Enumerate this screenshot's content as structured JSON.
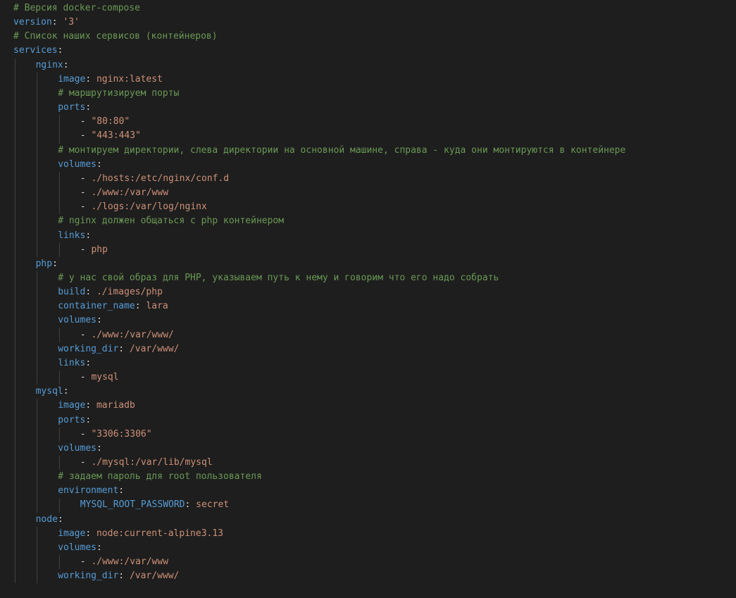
{
  "editor": {
    "language": "yaml",
    "theme": "dark",
    "colors": {
      "background": "#1e1e1e",
      "comment": "#6a9955",
      "key": "#569cd6",
      "string": "#ce9178",
      "punctuation": "#d4d4d4",
      "indent_guide": "#404040",
      "active_indent_guide": "#707070"
    },
    "current_line": 41,
    "lines": [
      {
        "indent": 0,
        "tokens": [
          {
            "t": "c",
            "v": "# Версия docker-compose"
          }
        ]
      },
      {
        "indent": 0,
        "tokens": [
          {
            "t": "k",
            "v": "version"
          },
          {
            "t": "p",
            "v": ": "
          },
          {
            "t": "s",
            "v": "'3'"
          }
        ]
      },
      {
        "indent": 0,
        "tokens": [
          {
            "t": "c",
            "v": "# Список наших сервисов (контейнеров)"
          }
        ]
      },
      {
        "indent": 0,
        "tokens": [
          {
            "t": "k",
            "v": "services"
          },
          {
            "t": "p",
            "v": ":"
          }
        ]
      },
      {
        "indent": 1,
        "tokens": [
          {
            "t": "k",
            "v": "nginx"
          },
          {
            "t": "p",
            "v": ":"
          }
        ]
      },
      {
        "indent": 2,
        "tokens": [
          {
            "t": "k",
            "v": "image"
          },
          {
            "t": "p",
            "v": ": "
          },
          {
            "t": "s",
            "v": "nginx:latest"
          }
        ]
      },
      {
        "indent": 2,
        "tokens": [
          {
            "t": "c",
            "v": "# маршрутизируем порты"
          }
        ]
      },
      {
        "indent": 2,
        "tokens": [
          {
            "t": "k",
            "v": "ports"
          },
          {
            "t": "p",
            "v": ":"
          }
        ]
      },
      {
        "indent": 3,
        "tokens": [
          {
            "t": "p",
            "v": "- "
          },
          {
            "t": "s",
            "v": "\"80:80\""
          }
        ]
      },
      {
        "indent": 3,
        "tokens": [
          {
            "t": "p",
            "v": "- "
          },
          {
            "t": "s",
            "v": "\"443:443\""
          }
        ]
      },
      {
        "indent": 2,
        "tokens": [
          {
            "t": "c",
            "v": "# монтируем директории, слева директории на основной машине, справа - куда они монтируются в контейнере"
          }
        ]
      },
      {
        "indent": 2,
        "tokens": [
          {
            "t": "k",
            "v": "volumes"
          },
          {
            "t": "p",
            "v": ":"
          }
        ]
      },
      {
        "indent": 3,
        "tokens": [
          {
            "t": "p",
            "v": "- "
          },
          {
            "t": "s",
            "v": "./hosts:/etc/nginx/conf.d"
          }
        ]
      },
      {
        "indent": 3,
        "tokens": [
          {
            "t": "p",
            "v": "- "
          },
          {
            "t": "s",
            "v": "./www:/var/www"
          }
        ]
      },
      {
        "indent": 3,
        "tokens": [
          {
            "t": "p",
            "v": "- "
          },
          {
            "t": "s",
            "v": "./logs:/var/log/nginx"
          }
        ]
      },
      {
        "indent": 2,
        "tokens": [
          {
            "t": "c",
            "v": "# nginx должен общаться с php контейнером"
          }
        ]
      },
      {
        "indent": 2,
        "tokens": [
          {
            "t": "k",
            "v": "links"
          },
          {
            "t": "p",
            "v": ":"
          }
        ]
      },
      {
        "indent": 3,
        "tokens": [
          {
            "t": "p",
            "v": "- "
          },
          {
            "t": "s",
            "v": "php"
          }
        ]
      },
      {
        "indent": 1,
        "tokens": [
          {
            "t": "k",
            "v": "php"
          },
          {
            "t": "p",
            "v": ":"
          }
        ]
      },
      {
        "indent": 2,
        "tokens": [
          {
            "t": "c",
            "v": "# у нас свой образ для PHP, указываем путь к нему и говорим что его надо собрать"
          }
        ]
      },
      {
        "indent": 2,
        "tokens": [
          {
            "t": "k",
            "v": "build"
          },
          {
            "t": "p",
            "v": ": "
          },
          {
            "t": "s",
            "v": "./images/php"
          }
        ]
      },
      {
        "indent": 2,
        "tokens": [
          {
            "t": "k",
            "v": "container_name"
          },
          {
            "t": "p",
            "v": ": "
          },
          {
            "t": "s",
            "v": "lara"
          }
        ]
      },
      {
        "indent": 2,
        "tokens": [
          {
            "t": "k",
            "v": "volumes"
          },
          {
            "t": "p",
            "v": ":"
          }
        ]
      },
      {
        "indent": 3,
        "tokens": [
          {
            "t": "p",
            "v": "- "
          },
          {
            "t": "s",
            "v": "./www:/var/www/"
          }
        ]
      },
      {
        "indent": 2,
        "tokens": [
          {
            "t": "k",
            "v": "working_dir"
          },
          {
            "t": "p",
            "v": ": "
          },
          {
            "t": "s",
            "v": "/var/www/"
          }
        ]
      },
      {
        "indent": 2,
        "tokens": [
          {
            "t": "k",
            "v": "links"
          },
          {
            "t": "p",
            "v": ":"
          }
        ]
      },
      {
        "indent": 3,
        "tokens": [
          {
            "t": "p",
            "v": "- "
          },
          {
            "t": "s",
            "v": "mysql"
          }
        ]
      },
      {
        "indent": 1,
        "tokens": [
          {
            "t": "k",
            "v": "mysql"
          },
          {
            "t": "p",
            "v": ":"
          }
        ]
      },
      {
        "indent": 2,
        "tokens": [
          {
            "t": "k",
            "v": "image"
          },
          {
            "t": "p",
            "v": ": "
          },
          {
            "t": "s",
            "v": "mariadb"
          }
        ]
      },
      {
        "indent": 2,
        "tokens": [
          {
            "t": "k",
            "v": "ports"
          },
          {
            "t": "p",
            "v": ":"
          }
        ]
      },
      {
        "indent": 3,
        "tokens": [
          {
            "t": "p",
            "v": "- "
          },
          {
            "t": "s",
            "v": "\"3306:3306\""
          }
        ]
      },
      {
        "indent": 2,
        "tokens": [
          {
            "t": "k",
            "v": "volumes"
          },
          {
            "t": "p",
            "v": ":"
          }
        ]
      },
      {
        "indent": 3,
        "tokens": [
          {
            "t": "p",
            "v": "- "
          },
          {
            "t": "s",
            "v": "./mysql:/var/lib/mysql"
          }
        ]
      },
      {
        "indent": 2,
        "tokens": [
          {
            "t": "c",
            "v": "# задаем пароль для root пользователя"
          }
        ]
      },
      {
        "indent": 2,
        "tokens": [
          {
            "t": "k",
            "v": "environment"
          },
          {
            "t": "p",
            "v": ":"
          }
        ]
      },
      {
        "indent": 3,
        "tokens": [
          {
            "t": "k",
            "v": "MYSQL_ROOT_PASSWORD"
          },
          {
            "t": "p",
            "v": ": "
          },
          {
            "t": "s",
            "v": "secret"
          }
        ]
      },
      {
        "indent": 1,
        "tokens": [
          {
            "t": "k",
            "v": "node"
          },
          {
            "t": "p",
            "v": ":"
          }
        ]
      },
      {
        "indent": 2,
        "tokens": [
          {
            "t": "k",
            "v": "image"
          },
          {
            "t": "p",
            "v": ": "
          },
          {
            "t": "s",
            "v": "node:current-alpine3.13"
          }
        ]
      },
      {
        "indent": 2,
        "tokens": [
          {
            "t": "k",
            "v": "volumes"
          },
          {
            "t": "p",
            "v": ":"
          }
        ]
      },
      {
        "indent": 3,
        "tokens": [
          {
            "t": "p",
            "v": "- "
          },
          {
            "t": "s",
            "v": "./www:/var/www"
          }
        ]
      },
      {
        "indent": 2,
        "tokens": [
          {
            "t": "k",
            "v": "working_dir"
          },
          {
            "t": "p",
            "v": ": "
          },
          {
            "t": "s",
            "v": "/var/www/"
          }
        ]
      }
    ]
  }
}
